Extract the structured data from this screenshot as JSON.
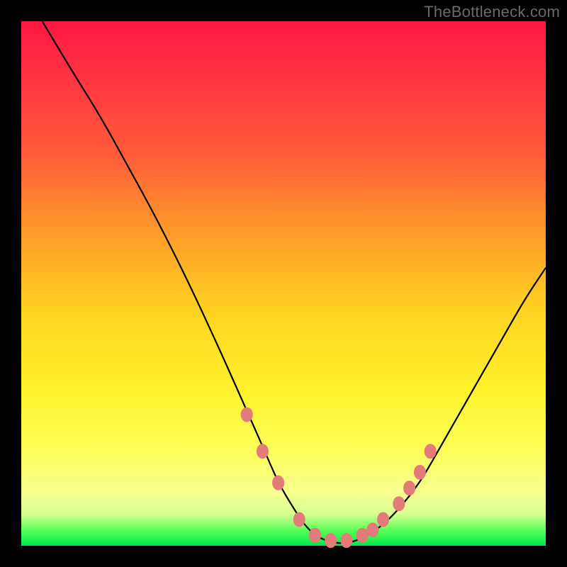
{
  "watermark": "TheBottleneck.com",
  "chart_data": {
    "type": "line",
    "title": "",
    "xlabel": "",
    "ylabel": "",
    "xlim": [
      0,
      100
    ],
    "ylim": [
      0,
      100
    ],
    "grid": false,
    "legend": false,
    "background_gradient": [
      "#ff1740",
      "#ff9a2a",
      "#fff22a",
      "#00e84a"
    ],
    "series": [
      {
        "name": "bottleneck-curve",
        "x": [
          4,
          10,
          15,
          20,
          26,
          32,
          38,
          42,
          46,
          49,
          52,
          54,
          56,
          58,
          60,
          62,
          64,
          66,
          69,
          72,
          76,
          80,
          84,
          88,
          92,
          96,
          100
        ],
        "y": [
          100,
          90,
          82,
          73,
          62,
          50,
          37,
          28,
          19,
          12,
          7,
          4,
          2,
          1,
          0.5,
          0.5,
          1,
          2,
          4,
          7,
          12,
          19,
          26,
          33,
          40,
          47,
          53
        ]
      }
    ],
    "markers": {
      "name": "highlight-points",
      "color": "#e37b78",
      "x": [
        43,
        46,
        49,
        53,
        56,
        59,
        62,
        65,
        67,
        69,
        72,
        74,
        76,
        78
      ],
      "y": [
        25,
        18,
        12,
        5,
        2,
        1,
        1,
        2,
        3,
        5,
        8,
        11,
        14,
        18
      ]
    }
  }
}
